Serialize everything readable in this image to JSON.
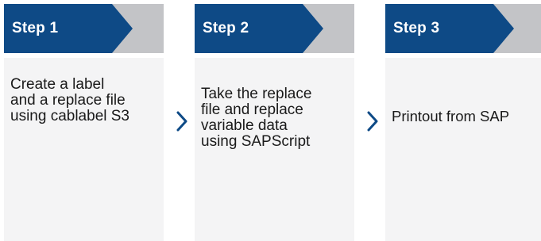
{
  "colors": {
    "header_blue": "#0e4a86",
    "header_gray": "#c3c4c7",
    "body_gray": "#f4f4f5",
    "chevron_blue": "#0e4a86",
    "text": "#1a1a1a"
  },
  "steps": [
    {
      "title": "Step 1",
      "text": "Create a label\nand a replace file\nusing cablabel S3"
    },
    {
      "title": "Step 2",
      "text": "Take the replace\nfile and replace\nvariable data\nusing SAPScript"
    },
    {
      "title": "Step 3",
      "text": "Printout from SAP"
    }
  ],
  "connectors": [
    {
      "icon": "chevron-right-icon"
    },
    {
      "icon": "chevron-right-icon"
    }
  ]
}
